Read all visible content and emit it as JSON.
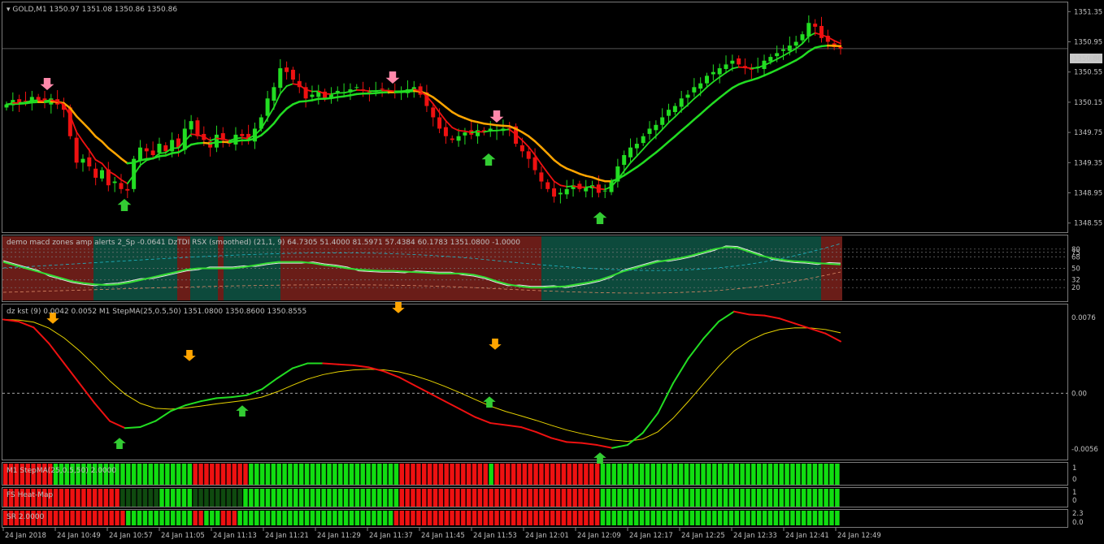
{
  "window": {
    "symbol_title": "GOLD,M1",
    "ohlc": "1350.97 1351.08 1350.86 1350.86",
    "current_price": "1350.86"
  },
  "colors": {
    "bull": "#22dd22",
    "bear": "#ee1111",
    "orange": "#ffa500",
    "pink": "#ff88aa",
    "green_arrow": "#33cc33",
    "teal_zone": "#0d4a3c",
    "red_zone": "#6a1d18"
  },
  "panels": {
    "indicator1_label": "demo macd zones amp alerts 2_Sp -0.0641  DzTDI  RSX (smoothed) (21,1, 9) 64.7305 51.4000 81.5971 57.4384 60.1783 1351.0800 -1.0000",
    "indicator2_label": "dz kst (9) 0.0042 0.0052  M1 StepMA(25,0.5,50) 1351.0800 1350.8600 1350.8555",
    "bar1_label": "M1 StepMA(25,0.5,50) 2.0000",
    "bar2_label": "FS Heat-Map",
    "bar3_label": "SR 2.0000"
  },
  "chart_data": [
    {
      "type": "candlestick",
      "title": "GOLD,M1",
      "ylim": [
        1348.45,
        1351.45
      ],
      "yticks": [
        "1351.35",
        "1350.95",
        "1350.55",
        "1350.15",
        "1349.75",
        "1349.35",
        "1348.95",
        "1348.55"
      ],
      "current_price": 1350.86,
      "close": [
        1350.12,
        1350.18,
        1350.14,
        1350.16,
        1350.22,
        1350.18,
        1350.15,
        1350.2,
        1350.12,
        1350.05,
        1349.7,
        1349.35,
        1349.4,
        1349.3,
        1349.15,
        1349.25,
        1349.05,
        1349.1,
        1349.0,
        1348.98,
        1349.4,
        1349.55,
        1349.5,
        1349.45,
        1349.6,
        1349.5,
        1349.65,
        1349.55,
        1349.8,
        1349.9,
        1349.7,
        1349.65,
        1349.55,
        1349.72,
        1349.65,
        1349.6,
        1349.72,
        1349.7,
        1349.65,
        1349.8,
        1349.95,
        1350.2,
        1350.35,
        1350.6,
        1350.55,
        1350.45,
        1350.35,
        1350.2,
        1350.25,
        1350.3,
        1350.2,
        1350.25,
        1350.3,
        1350.28,
        1350.32,
        1350.35,
        1350.3,
        1350.28,
        1350.3,
        1350.32,
        1350.3,
        1350.28,
        1350.3,
        1350.32,
        1350.35,
        1350.25,
        1350.1,
        1349.95,
        1349.8,
        1349.7,
        1349.65,
        1349.7,
        1349.75,
        1349.72,
        1349.78,
        1349.75,
        1349.8,
        1349.78,
        1349.8,
        1349.8,
        1349.6,
        1349.5,
        1349.4,
        1349.25,
        1349.1,
        1349.0,
        1348.9,
        1348.95,
        1349.0,
        1349.05,
        1349.0,
        1349.02,
        1349.05,
        1348.95,
        1348.98,
        1349.1,
        1349.3,
        1349.45,
        1349.55,
        1349.6,
        1349.7,
        1349.8,
        1349.85,
        1349.95,
        1350.05,
        1350.1,
        1350.2,
        1350.25,
        1350.35,
        1350.4,
        1350.5,
        1350.55,
        1350.6,
        1350.65,
        1350.7,
        1350.65,
        1350.6,
        1350.58,
        1350.62,
        1350.7,
        1350.75,
        1350.8,
        1350.85,
        1350.9,
        1350.95,
        1351.05,
        1351.2,
        1351.15,
        1351.0,
        1350.95,
        1350.88,
        1350.86
      ]
    },
    {
      "type": "line",
      "title": "DzTDI RSX (smoothed)",
      "ylim": [
        0,
        100
      ],
      "yticks": [
        "80",
        "75",
        "68",
        "50",
        "32",
        "20"
      ],
      "series": [
        {
          "name": "RSX (smoothed)",
          "values": [
            60,
            55,
            50,
            45,
            40,
            35,
            30,
            27,
            25,
            24,
            25,
            28,
            32,
            36,
            40,
            44,
            48,
            50,
            50,
            50,
            50,
            52,
            55,
            58,
            60,
            60,
            60,
            58,
            55,
            53,
            50,
            48,
            47,
            46,
            46,
            45,
            44,
            43,
            42,
            42,
            42,
            40,
            36,
            30,
            25,
            22,
            20,
            20,
            21,
            22,
            25,
            28,
            32,
            38,
            45,
            50,
            55,
            60,
            63,
            66,
            70,
            75,
            80,
            83,
            82,
            76,
            70,
            66,
            63,
            61,
            60,
            58,
            57,
            56
          ]
        }
      ]
    },
    {
      "type": "line",
      "title": "dz kst (9)",
      "ylim": [
        -0.0065,
        0.0085
      ],
      "yticks": [
        "0.0076",
        "0.00",
        "-0.0056"
      ],
      "series": [
        {
          "name": "dz kst (9)",
          "values": [
            0.0074,
            0.0072,
            0.0066,
            0.005,
            0.003,
            0.001,
            -0.001,
            -0.0028,
            -0.0035,
            -0.0034,
            -0.0028,
            -0.0018,
            -0.0012,
            -0.0008,
            -0.0005,
            -0.0004,
            -0.0002,
            0.0004,
            0.0015,
            0.0025,
            0.003,
            0.003,
            0.0029,
            0.0028,
            0.0026,
            0.0022,
            0.0016,
            0.0008,
            0.0,
            -0.0008,
            -0.0016,
            -0.0024,
            -0.003,
            -0.0032,
            -0.0034,
            -0.0039,
            -0.0045,
            -0.0049,
            -0.005,
            -0.0052,
            -0.0055,
            -0.0052,
            -0.004,
            -0.002,
            0.001,
            0.0035,
            0.0055,
            0.0072,
            0.0082,
            0.0079,
            0.0078,
            0.0075,
            0.007,
            0.0065,
            0.006,
            0.0052
          ]
        }
      ]
    }
  ]
}
